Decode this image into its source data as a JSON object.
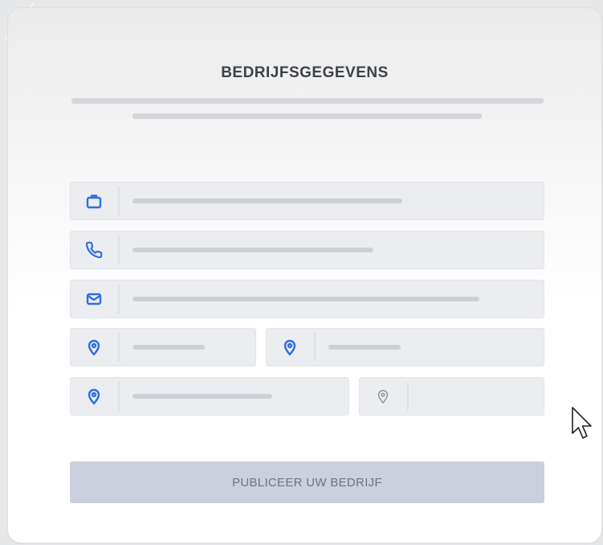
{
  "form": {
    "title": "BEDRIJFSGEGEVENS",
    "fields": [
      {
        "name": "company-field",
        "icon": "briefcase-icon"
      },
      {
        "name": "phone-field",
        "icon": "phone-icon"
      },
      {
        "name": "email-field",
        "icon": "mail-icon"
      },
      {
        "name": "location-field",
        "icon": "map-pin-icon"
      },
      {
        "name": "location-field",
        "icon": "map-pin-icon"
      },
      {
        "name": "location-field",
        "icon": "map-pin-icon"
      },
      {
        "name": "location-field",
        "icon": "map-pin-icon"
      }
    ],
    "submit_label": "PUBLICEER UW BEDRIJF"
  },
  "colors": {
    "accent": "#2f6fe0",
    "button_bg": "#cad1dd",
    "field_bg": "#ecedf0"
  }
}
